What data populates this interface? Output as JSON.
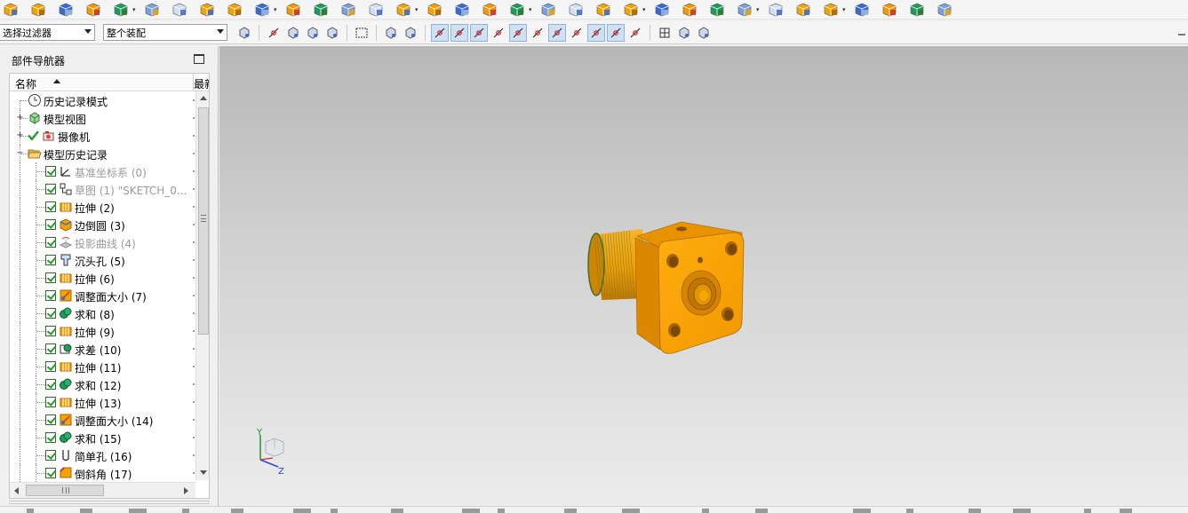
{
  "toolbar": {
    "selection_filter": "选择过滤器",
    "scope": "整个装配"
  },
  "navigator": {
    "title": "部件导航器",
    "columns": {
      "name": "名称",
      "latest": "最新"
    },
    "items": [
      {
        "label": "历史记录模式",
        "icon": "clock-icon",
        "kind": "root-plain"
      },
      {
        "label": "模型视图",
        "icon": "model-views-icon",
        "kind": "root-expand"
      },
      {
        "label": "摄像机",
        "icon": "camera-icon",
        "kind": "root-expand-check"
      },
      {
        "label": "模型历史记录",
        "icon": "folder-open-icon",
        "kind": "root-collapse"
      },
      {
        "label": "基准坐标系 (0)",
        "icon": "datum-csys-icon",
        "dim": true
      },
      {
        "label": "草图 (1) \"SKETCH_0...",
        "icon": "sketch-icon",
        "dim": true
      },
      {
        "label": "拉伸 (2)",
        "icon": "extrude-icon"
      },
      {
        "label": "边倒圆 (3)",
        "icon": "edge-blend-icon"
      },
      {
        "label": "投影曲线 (4)",
        "icon": "project-curve-icon",
        "dim": true
      },
      {
        "label": "沉头孔 (5)",
        "icon": "counterbore-hole-icon"
      },
      {
        "label": "拉伸 (6)",
        "icon": "extrude-icon"
      },
      {
        "label": "调整面大小 (7)",
        "icon": "resize-face-icon"
      },
      {
        "label": "求和 (8)",
        "icon": "unite-icon"
      },
      {
        "label": "拉伸 (9)",
        "icon": "extrude-icon"
      },
      {
        "label": "求差 (10)",
        "icon": "subtract-icon"
      },
      {
        "label": "拉伸 (11)",
        "icon": "extrude-icon"
      },
      {
        "label": "求和 (12)",
        "icon": "unite-icon"
      },
      {
        "label": "拉伸 (13)",
        "icon": "extrude-icon"
      },
      {
        "label": "调整面大小 (14)",
        "icon": "resize-face-icon"
      },
      {
        "label": "求和 (15)",
        "icon": "unite-icon"
      },
      {
        "label": "简单孔 (16)",
        "icon": "simple-hole-icon"
      },
      {
        "label": "倒斜角 (17)",
        "icon": "chamfer-icon"
      }
    ]
  },
  "triad": {
    "y": "Y",
    "z": "Z"
  },
  "colors": {
    "part": "#f2a300",
    "part_dark": "#c77d00",
    "thread": "#3c6e3c"
  }
}
